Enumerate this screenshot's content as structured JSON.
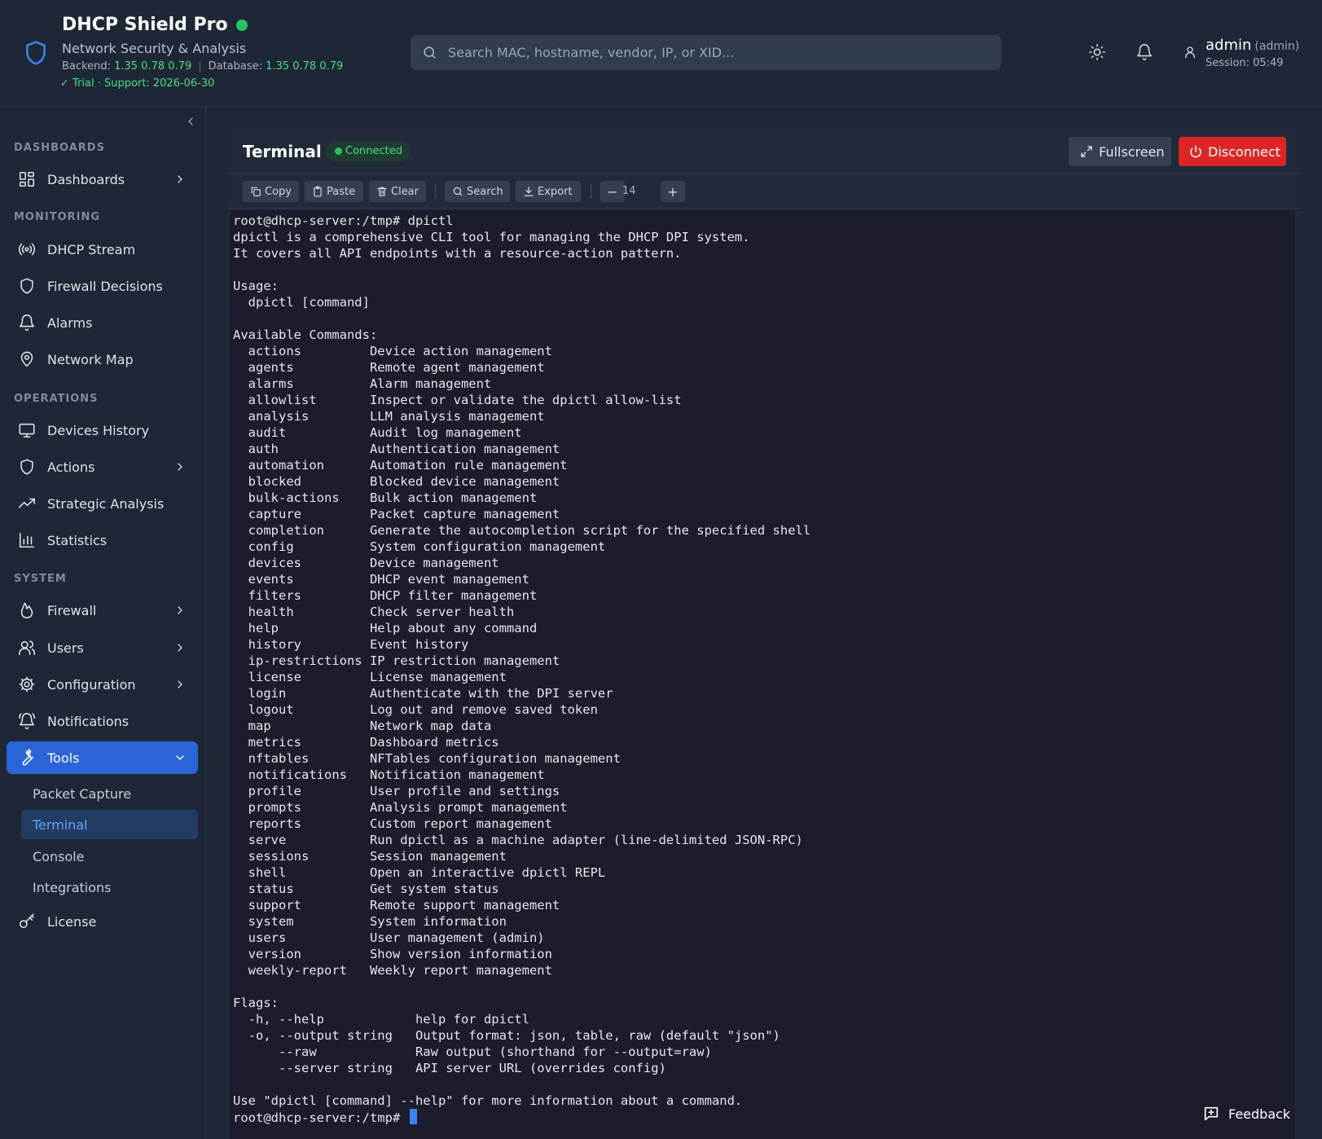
{
  "header": {
    "title": "DHCP Shield Pro",
    "subtitle": "Network Security & Analysis",
    "backend_label": "Backend:",
    "backend_version": "1.35 0.78 0.79",
    "database_label": "Database:",
    "database_version": "1.35 0.78 0.79",
    "trial": "✓ Trial · Support: 2026-06-30",
    "search_placeholder": "Search MAC, hostname, vendor, IP, or XID...",
    "user_name": "admin",
    "user_role": "(admin)",
    "session": "Session: 05:49"
  },
  "sidebar": {
    "sections": {
      "dashboards": "DASHBOARDS",
      "monitoring": "MONITORING",
      "operations": "OPERATIONS",
      "system": "SYSTEM"
    },
    "items": {
      "dashboards": "Dashboards",
      "dhcp_stream": "DHCP Stream",
      "firewall_decisions": "Firewall Decisions",
      "alarms": "Alarms",
      "network_map": "Network Map",
      "devices_history": "Devices History",
      "actions": "Actions",
      "strategic_analysis": "Strategic Analysis",
      "statistics": "Statistics",
      "firewall": "Firewall",
      "users": "Users",
      "configuration": "Configuration",
      "notifications": "Notifications",
      "tools": "Tools",
      "license": "License"
    },
    "tools_sub": {
      "packet_capture": "Packet Capture",
      "terminal": "Terminal",
      "console": "Console",
      "integrations": "Integrations"
    }
  },
  "panel": {
    "title": "Terminal",
    "status": "Connected",
    "fullscreen": "Fullscreen",
    "disconnect": "Disconnect",
    "toolbar": {
      "copy": "Copy",
      "paste": "Paste",
      "clear": "Clear",
      "search": "Search",
      "export": "Export",
      "minus": "−",
      "font_size": "14",
      "plus": "+"
    },
    "terminal_output": "root@dhcp-server:/tmp# dpictl\ndpictl is a comprehensive CLI tool for managing the DHCP DPI system.\nIt covers all API endpoints with a resource-action pattern.\n\nUsage:\n  dpictl [command]\n\nAvailable Commands:\n  actions         Device action management\n  agents          Remote agent management\n  alarms          Alarm management\n  allowlist       Inspect or validate the dpictl allow-list\n  analysis        LLM analysis management\n  audit           Audit log management\n  auth            Authentication management\n  automation      Automation rule management\n  blocked         Blocked device management\n  bulk-actions    Bulk action management\n  capture         Packet capture management\n  completion      Generate the autocompletion script for the specified shell\n  config          System configuration management\n  devices         Device management\n  events          DHCP event management\n  filters         DHCP filter management\n  health          Check server health\n  help            Help about any command\n  history         Event history\n  ip-restrictions IP restriction management\n  license         License management\n  login           Authenticate with the DPI server\n  logout          Log out and remove saved token\n  map             Network map data\n  metrics         Dashboard metrics\n  nftables        NFTables configuration management\n  notifications   Notification management\n  profile         User profile and settings\n  prompts         Analysis prompt management\n  reports         Custom report management\n  serve           Run dpictl as a machine adapter (line-delimited JSON-RPC)\n  sessions        Session management\n  shell           Open an interactive dpictl REPL\n  status          Get system status\n  support         Remote support management\n  system          System information\n  users           User management (admin)\n  version         Show version information\n  weekly-report   Weekly report management\n\nFlags:\n  -h, --help            help for dpictl\n  -o, --output string   Output format: json, table, raw (default \"json\")\n      --raw             Raw output (shorthand for --output=raw)\n      --server string   API server URL (overrides config)\n\nUse \"dpictl [command] --help\" for more information about a command.",
    "prompt": "root@dhcp-server:/tmp# "
  },
  "feedback": "Feedback",
  "colors": {
    "accent": "#2b63d9",
    "success": "#22c55e",
    "danger": "#dc2626",
    "background": "#1e2735",
    "terminal_bg": "#1b1c2c"
  }
}
